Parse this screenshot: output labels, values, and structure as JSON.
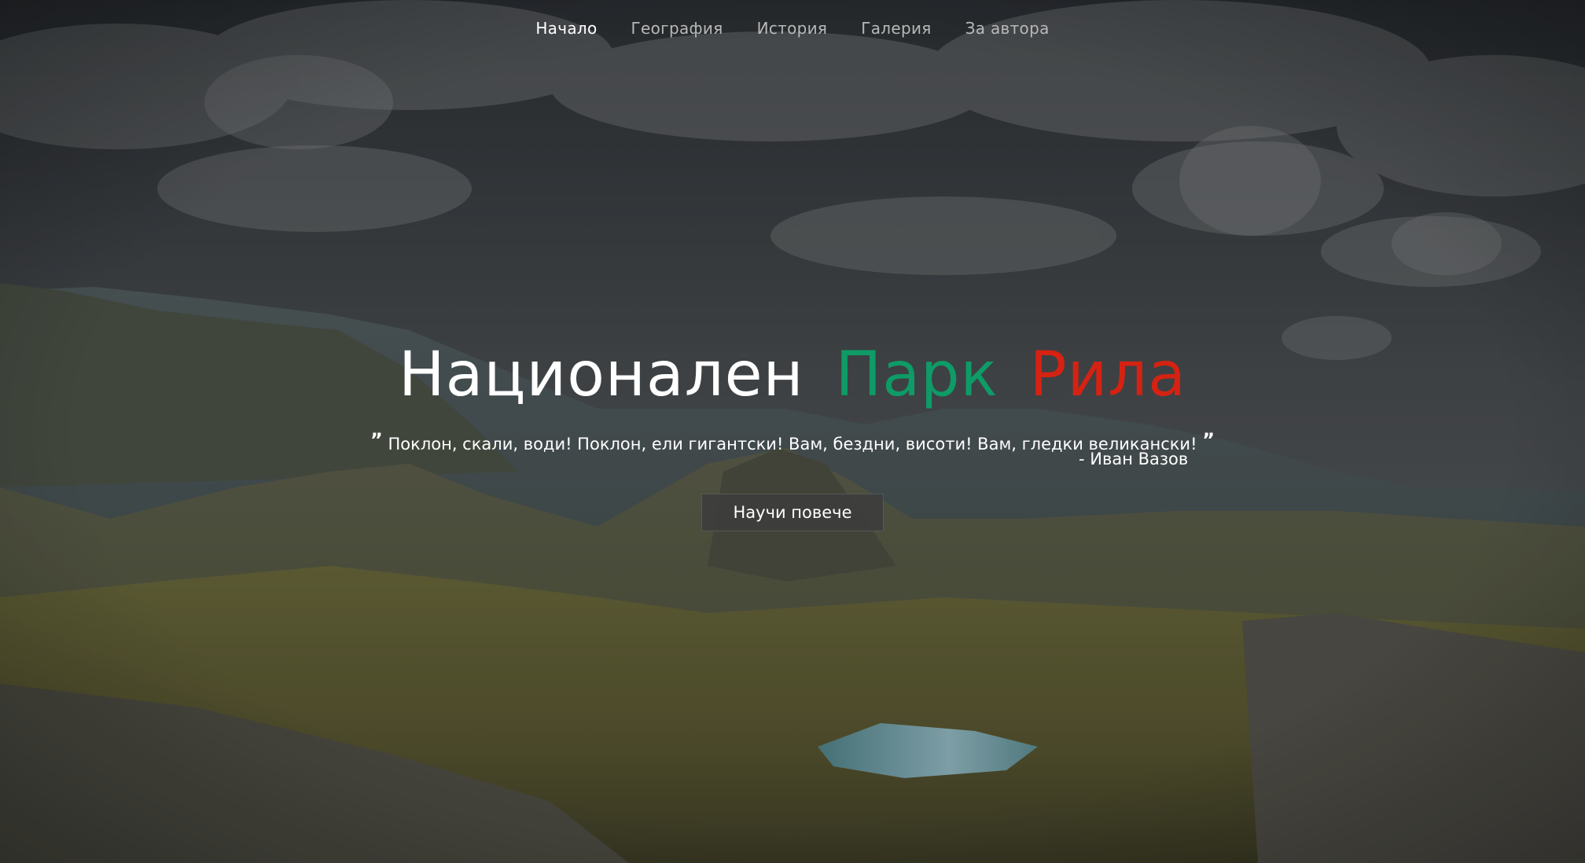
{
  "nav": {
    "items": [
      {
        "label": "Начало",
        "active": true
      },
      {
        "label": "География",
        "active": false
      },
      {
        "label": "История",
        "active": false
      },
      {
        "label": "Галерия",
        "active": false
      },
      {
        "label": "За автора",
        "active": false
      }
    ]
  },
  "hero": {
    "title": {
      "word1": "Национален",
      "word2": "Парк",
      "word3": "Рила"
    },
    "quote": {
      "open_mark": "”",
      "text": "Поклон, скали, води! Поклон, ели гигантски! Вам, бездни, висоти! Вам, гледки великански!",
      "close_mark": "”",
      "author": "- Иван Вазов"
    },
    "cta_label": "Научи повече"
  },
  "colors": {
    "title_white": "#ffffff",
    "title_green": "#0e9b67",
    "title_red": "#d52212",
    "nav_inactive": "#b8b8b8",
    "nav_active": "#ffffff",
    "button_bg": "#3c3c3c"
  }
}
